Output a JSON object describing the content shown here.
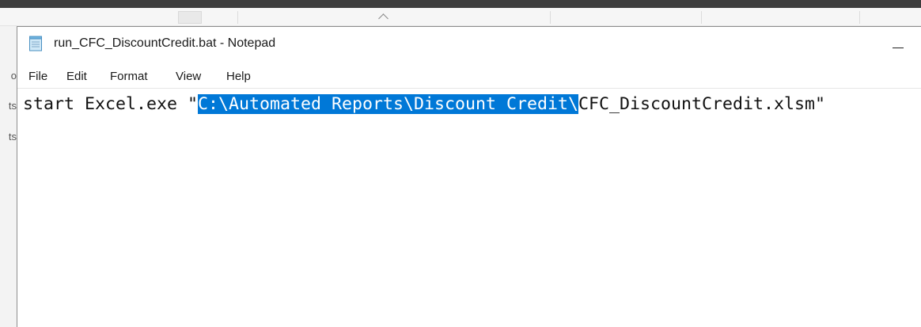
{
  "notepad": {
    "title": "run_CFC_DiscountCredit.bat - Notepad",
    "icon": "notepad-icon",
    "controls": {
      "minimize_label": "—"
    },
    "menu": {
      "file": "File",
      "edit": "Edit",
      "format": "Format",
      "view": "View",
      "help": "Help"
    },
    "content": {
      "line_before_selection": "start Excel.exe \"",
      "selected_text": "C:\\Automated Reports\\Discount Credit\\",
      "line_after_selection": "CFC_DiscountCredit.xlsm\""
    },
    "colors": {
      "selection_background": "#0078d7",
      "selection_text": "#ffffff"
    }
  },
  "background_window": {
    "side_fragments": [
      "o",
      "ts",
      "ts"
    ]
  }
}
